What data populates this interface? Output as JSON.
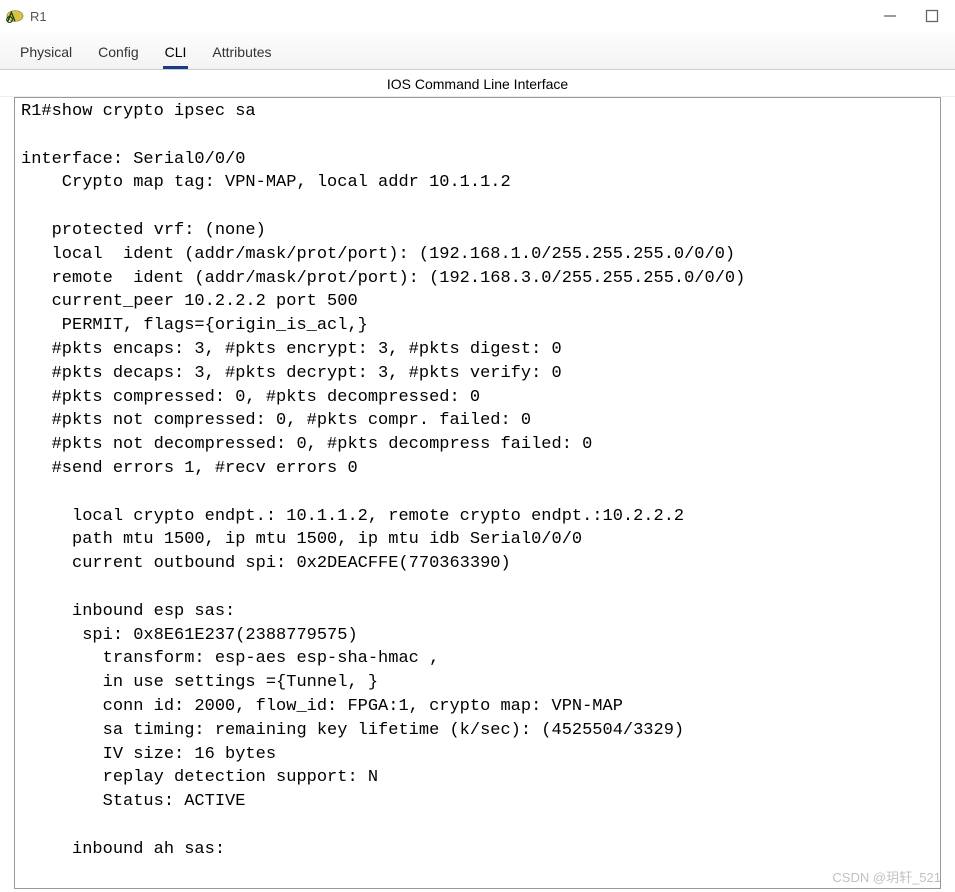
{
  "window": {
    "title": "R1"
  },
  "tabs": {
    "items": [
      {
        "label": "Physical"
      },
      {
        "label": "Config"
      },
      {
        "label": "CLI"
      },
      {
        "label": "Attributes"
      }
    ],
    "active_index": 2
  },
  "subtitle": "IOS Command Line Interface",
  "terminal": {
    "prompt_line": "R1#show crypto ipsec sa",
    "lines": [
      "",
      "interface: Serial0/0/0",
      "    Crypto map tag: VPN-MAP, local addr 10.1.1.2",
      "",
      "   protected vrf: (none)",
      "   local  ident (addr/mask/prot/port): (192.168.1.0/255.255.255.0/0/0)",
      "   remote  ident (addr/mask/prot/port): (192.168.3.0/255.255.255.0/0/0)",
      "   current_peer 10.2.2.2 port 500",
      "    PERMIT, flags={origin_is_acl,}",
      "   #pkts encaps: 3, #pkts encrypt: 3, #pkts digest: 0",
      "   #pkts decaps: 3, #pkts decrypt: 3, #pkts verify: 0",
      "   #pkts compressed: 0, #pkts decompressed: 0",
      "   #pkts not compressed: 0, #pkts compr. failed: 0",
      "   #pkts not decompressed: 0, #pkts decompress failed: 0",
      "   #send errors 1, #recv errors 0",
      "",
      "     local crypto endpt.: 10.1.1.2, remote crypto endpt.:10.2.2.2",
      "     path mtu 1500, ip mtu 1500, ip mtu idb Serial0/0/0",
      "     current outbound spi: 0x2DEACFFE(770363390)",
      "",
      "     inbound esp sas:",
      "      spi: 0x8E61E237(2388779575)",
      "        transform: esp-aes esp-sha-hmac ,",
      "        in use settings ={Tunnel, }",
      "        conn id: 2000, flow_id: FPGA:1, crypto map: VPN-MAP",
      "        sa timing: remaining key lifetime (k/sec): (4525504/3329)",
      "        IV size: 16 bytes",
      "        replay detection support: N",
      "        Status: ACTIVE",
      "",
      "     inbound ah sas:"
    ]
  },
  "watermark": "CSDN @玥轩_521"
}
